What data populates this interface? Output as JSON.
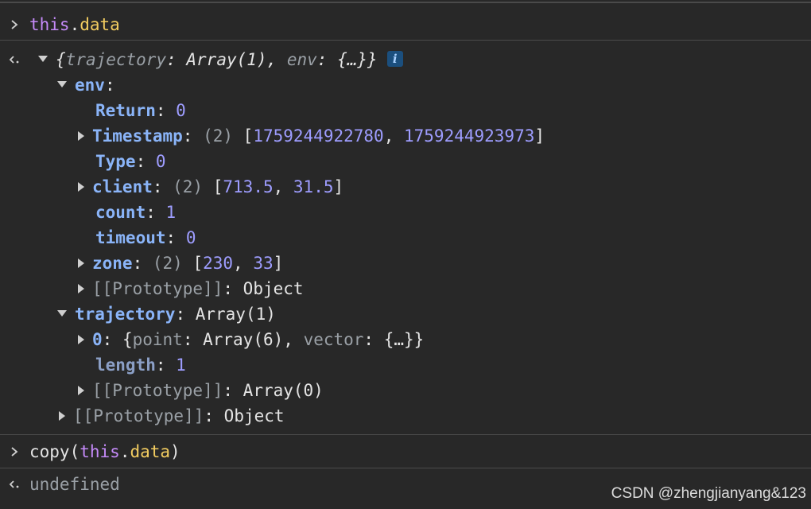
{
  "console": {
    "input1": {
      "obj": "this",
      "dot": ".",
      "prop": "data"
    },
    "result": {
      "summary": {
        "open": "{",
        "k1": "trajectory",
        "colon1": ": ",
        "v1": "Array(1)",
        "comma": ", ",
        "k2": "env",
        "colon2": ": ",
        "v2": "{…}",
        "close": "}",
        "badge": "i"
      },
      "env": {
        "label": "env",
        "colon": ":",
        "return_key": "Return",
        "return_val": "0",
        "timestamp_key": "Timestamp",
        "timestamp_len": "(2)",
        "timestamp_v1": "1759244922780",
        "timestamp_v2": "1759244923973",
        "type_key": "Type",
        "type_val": "0",
        "client_key": "client",
        "client_len": "(2)",
        "client_v1": "713.5",
        "client_v2": "31.5",
        "count_key": "count",
        "count_val": "1",
        "timeout_key": "timeout",
        "timeout_val": "0",
        "zone_key": "zone",
        "zone_len": "(2)",
        "zone_v1": "230",
        "zone_v2": "33",
        "proto_key": "[[Prototype]]",
        "proto_val": "Object"
      },
      "trajectory": {
        "label": "trajectory",
        "value": "Array(1)",
        "item0_key": "0",
        "item0_k1": "point",
        "item0_v1": "Array(6)",
        "item0_k2": "vector",
        "item0_v2": "{…}",
        "length_key": "length",
        "length_val": "1",
        "proto_key": "[[Prototype]]",
        "proto_val": "Array(0)"
      },
      "root_proto_key": "[[Prototype]]",
      "root_proto_val": "Object"
    },
    "input2": {
      "fn": "copy",
      "open": "(",
      "obj": "this",
      "dot": ".",
      "prop": "data",
      "close": ")"
    },
    "result2": "undefined"
  },
  "watermark": "CSDN @zhengjianyang&123"
}
